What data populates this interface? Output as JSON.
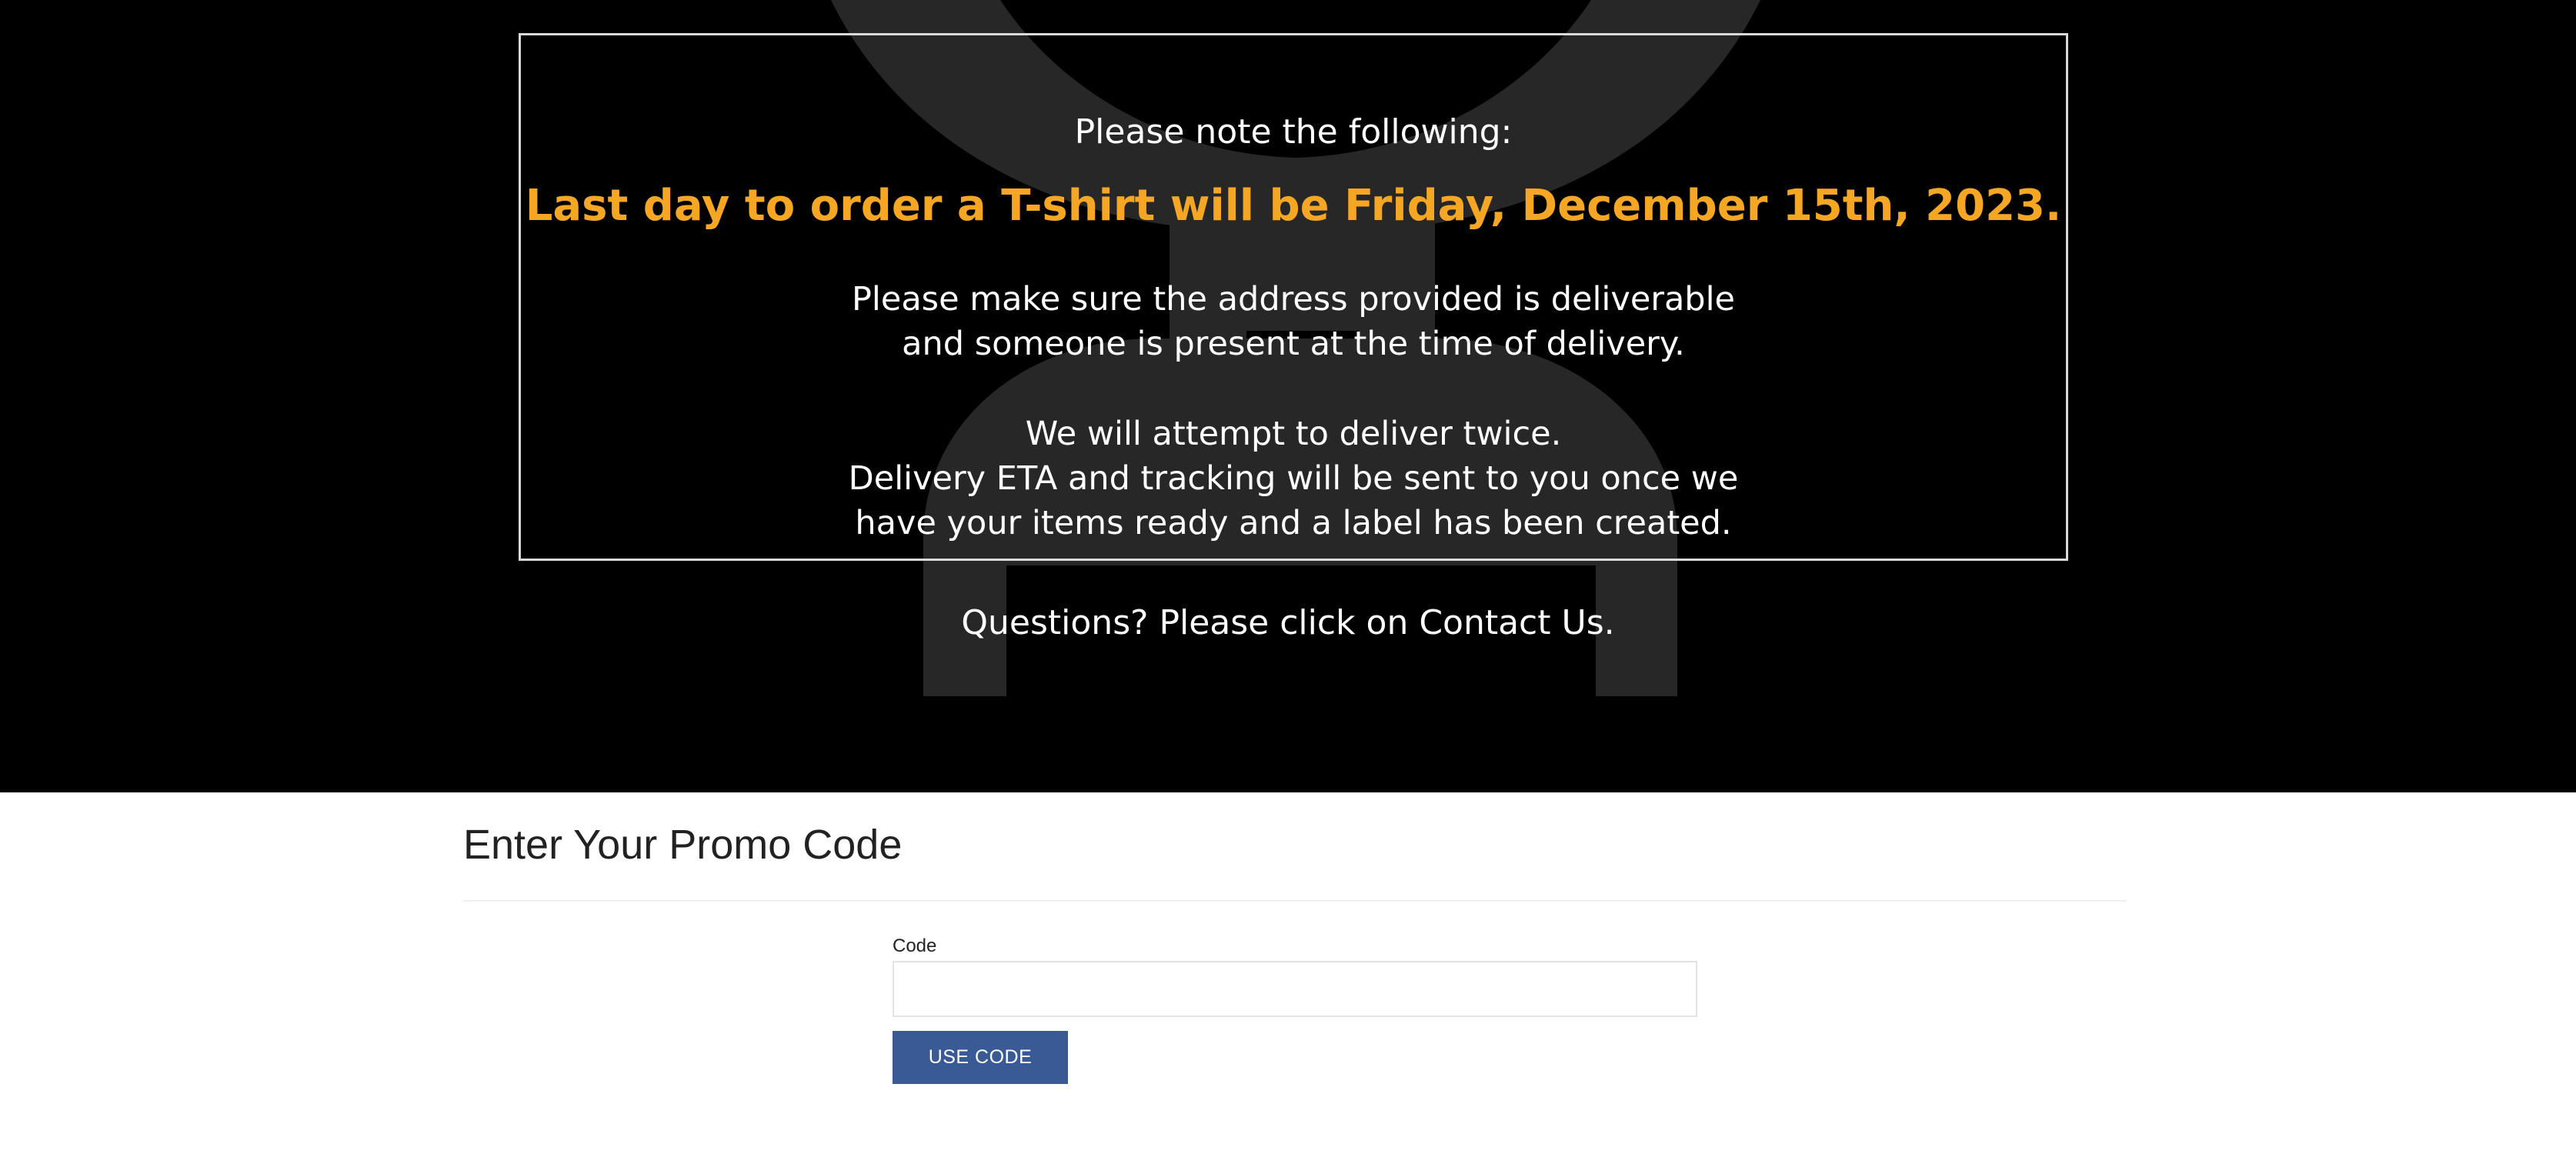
{
  "notice": {
    "heading": "Please note the following:",
    "highlight": "Last day to order a T-shirt will be Friday, December 15th, 2023.",
    "paragraph1": [
      "Please make sure the address provided is deliverable",
      "and someone is present at the time of delivery."
    ],
    "paragraph2": [
      "We will attempt to deliver twice.",
      "Delivery ETA and tracking will be sent to you once we",
      "have your items ready and a label has been created."
    ],
    "questions": "Questions? Please click on Contact Us."
  },
  "promo": {
    "title": "Enter Your Promo Code",
    "code_label": "Code",
    "code_value": "",
    "code_placeholder": "",
    "button_label": "USE CODE"
  },
  "colors": {
    "hero_background": "#000000",
    "highlight": "#f5a623",
    "button": "#3a5a96",
    "watermark": "#272727"
  },
  "icons": {
    "background_watermark": "antler-logo-icon"
  }
}
